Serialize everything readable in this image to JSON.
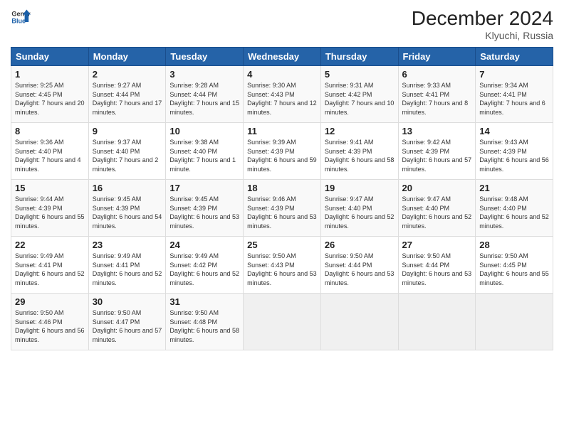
{
  "logo": {
    "line1": "General",
    "line2": "Blue"
  },
  "title": "December 2024",
  "location": "Klyuchi, Russia",
  "days_header": [
    "Sunday",
    "Monday",
    "Tuesday",
    "Wednesday",
    "Thursday",
    "Friday",
    "Saturday"
  ],
  "weeks": [
    [
      {
        "day": "1",
        "sunrise": "9:25 AM",
        "sunset": "4:45 PM",
        "daylight": "7 hours and 20 minutes."
      },
      {
        "day": "2",
        "sunrise": "9:27 AM",
        "sunset": "4:44 PM",
        "daylight": "7 hours and 17 minutes."
      },
      {
        "day": "3",
        "sunrise": "9:28 AM",
        "sunset": "4:44 PM",
        "daylight": "7 hours and 15 minutes."
      },
      {
        "day": "4",
        "sunrise": "9:30 AM",
        "sunset": "4:43 PM",
        "daylight": "7 hours and 12 minutes."
      },
      {
        "day": "5",
        "sunrise": "9:31 AM",
        "sunset": "4:42 PM",
        "daylight": "7 hours and 10 minutes."
      },
      {
        "day": "6",
        "sunrise": "9:33 AM",
        "sunset": "4:41 PM",
        "daylight": "7 hours and 8 minutes."
      },
      {
        "day": "7",
        "sunrise": "9:34 AM",
        "sunset": "4:41 PM",
        "daylight": "7 hours and 6 minutes."
      }
    ],
    [
      {
        "day": "8",
        "sunrise": "9:36 AM",
        "sunset": "4:40 PM",
        "daylight": "7 hours and 4 minutes."
      },
      {
        "day": "9",
        "sunrise": "9:37 AM",
        "sunset": "4:40 PM",
        "daylight": "7 hours and 2 minutes."
      },
      {
        "day": "10",
        "sunrise": "9:38 AM",
        "sunset": "4:40 PM",
        "daylight": "7 hours and 1 minute."
      },
      {
        "day": "11",
        "sunrise": "9:39 AM",
        "sunset": "4:39 PM",
        "daylight": "6 hours and 59 minutes."
      },
      {
        "day": "12",
        "sunrise": "9:41 AM",
        "sunset": "4:39 PM",
        "daylight": "6 hours and 58 minutes."
      },
      {
        "day": "13",
        "sunrise": "9:42 AM",
        "sunset": "4:39 PM",
        "daylight": "6 hours and 57 minutes."
      },
      {
        "day": "14",
        "sunrise": "9:43 AM",
        "sunset": "4:39 PM",
        "daylight": "6 hours and 56 minutes."
      }
    ],
    [
      {
        "day": "15",
        "sunrise": "9:44 AM",
        "sunset": "4:39 PM",
        "daylight": "6 hours and 55 minutes."
      },
      {
        "day": "16",
        "sunrise": "9:45 AM",
        "sunset": "4:39 PM",
        "daylight": "6 hours and 54 minutes."
      },
      {
        "day": "17",
        "sunrise": "9:45 AM",
        "sunset": "4:39 PM",
        "daylight": "6 hours and 53 minutes."
      },
      {
        "day": "18",
        "sunrise": "9:46 AM",
        "sunset": "4:39 PM",
        "daylight": "6 hours and 53 minutes."
      },
      {
        "day": "19",
        "sunrise": "9:47 AM",
        "sunset": "4:40 PM",
        "daylight": "6 hours and 52 minutes."
      },
      {
        "day": "20",
        "sunrise": "9:47 AM",
        "sunset": "4:40 PM",
        "daylight": "6 hours and 52 minutes."
      },
      {
        "day": "21",
        "sunrise": "9:48 AM",
        "sunset": "4:40 PM",
        "daylight": "6 hours and 52 minutes."
      }
    ],
    [
      {
        "day": "22",
        "sunrise": "9:49 AM",
        "sunset": "4:41 PM",
        "daylight": "6 hours and 52 minutes."
      },
      {
        "day": "23",
        "sunrise": "9:49 AM",
        "sunset": "4:41 PM",
        "daylight": "6 hours and 52 minutes."
      },
      {
        "day": "24",
        "sunrise": "9:49 AM",
        "sunset": "4:42 PM",
        "daylight": "6 hours and 52 minutes."
      },
      {
        "day": "25",
        "sunrise": "9:50 AM",
        "sunset": "4:43 PM",
        "daylight": "6 hours and 53 minutes."
      },
      {
        "day": "26",
        "sunrise": "9:50 AM",
        "sunset": "4:44 PM",
        "daylight": "6 hours and 53 minutes."
      },
      {
        "day": "27",
        "sunrise": "9:50 AM",
        "sunset": "4:44 PM",
        "daylight": "6 hours and 53 minutes."
      },
      {
        "day": "28",
        "sunrise": "9:50 AM",
        "sunset": "4:45 PM",
        "daylight": "6 hours and 55 minutes."
      }
    ],
    [
      {
        "day": "29",
        "sunrise": "9:50 AM",
        "sunset": "4:46 PM",
        "daylight": "6 hours and 56 minutes."
      },
      {
        "day": "30",
        "sunrise": "9:50 AM",
        "sunset": "4:47 PM",
        "daylight": "6 hours and 57 minutes."
      },
      {
        "day": "31",
        "sunrise": "9:50 AM",
        "sunset": "4:48 PM",
        "daylight": "6 hours and 58 minutes."
      },
      null,
      null,
      null,
      null
    ]
  ]
}
